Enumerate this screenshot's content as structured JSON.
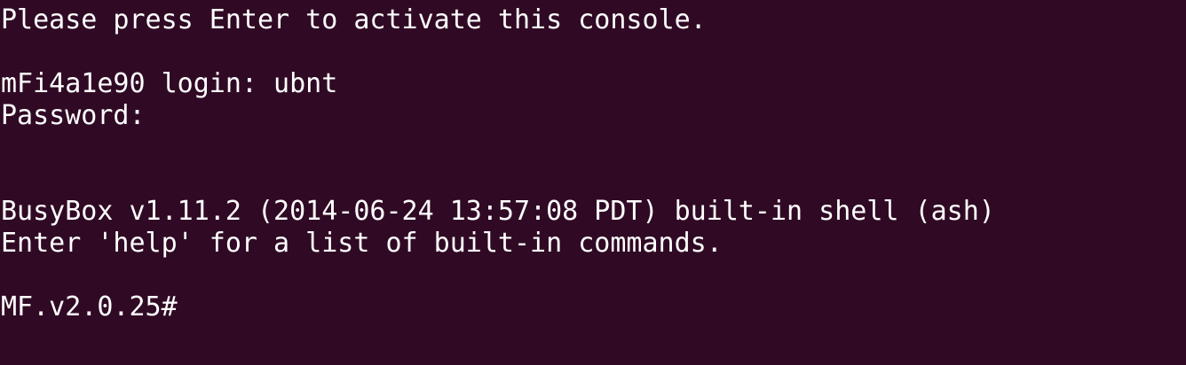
{
  "terminal": {
    "lines": [
      "Please press Enter to activate this console.",
      "",
      "mFi4a1e90 login: ubnt",
      "Password:",
      "",
      "",
      "BusyBox v1.11.2 (2014-06-24 13:57:08 PDT) built-in shell (ash)",
      "Enter 'help' for a list of built-in commands.",
      ""
    ],
    "prompt": "MF.v2.0.25#",
    "colors": {
      "background": "#300a24",
      "foreground": "#ffffff"
    }
  }
}
